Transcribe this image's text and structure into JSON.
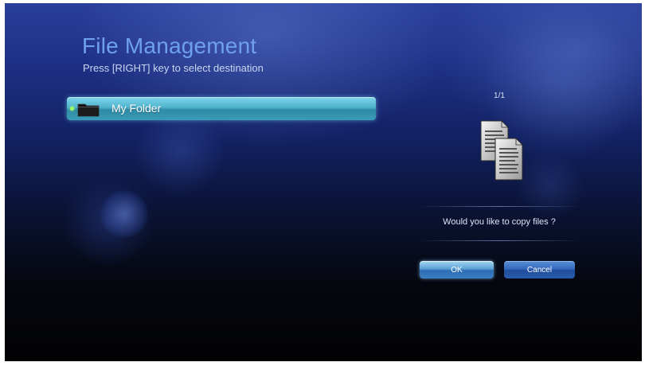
{
  "header": {
    "title": "File Management",
    "subtitle": "Press [RIGHT] key to select destination"
  },
  "folder_list": {
    "items": [
      {
        "label": "My Folder",
        "icon": "folder-icon",
        "selected": true
      }
    ]
  },
  "right_panel": {
    "page_indicator": "1/1",
    "icon": "copy-files-icon",
    "prompt": "Would you like to copy files ?"
  },
  "dialog_buttons": {
    "ok_label": "OK",
    "cancel_label": "Cancel"
  },
  "colors": {
    "title": "#6fa0ee",
    "selection_highlight": "#4fb2cc",
    "background_top": "#2a3f9a",
    "background_bottom": "#020204"
  }
}
